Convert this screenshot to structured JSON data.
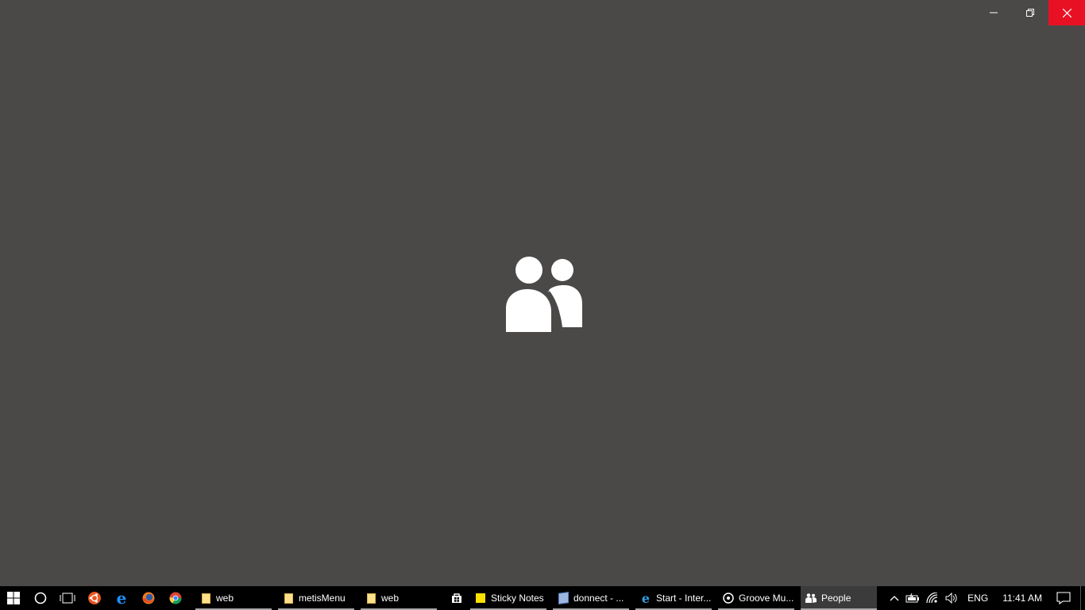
{
  "window": {
    "caption": {
      "minimize_icon": "minimize-icon",
      "restore_icon": "restore-icon",
      "close_icon": "close-icon"
    },
    "splash_icon": "people-icon",
    "background_color": "#4a4948",
    "close_hover_color": "#e81123"
  },
  "taskbar": {
    "pinned": [
      {
        "name": "start-button",
        "icon": "windows-logo-icon"
      },
      {
        "name": "cortana-button",
        "icon": "cortana-circle-icon"
      },
      {
        "name": "task-view-button",
        "icon": "task-view-icon"
      },
      {
        "name": "ubuntu-button",
        "icon": "ubuntu-icon"
      },
      {
        "name": "edge-button",
        "icon": "edge-icon"
      },
      {
        "name": "firefox-button",
        "icon": "firefox-icon"
      },
      {
        "name": "chrome-button",
        "icon": "chrome-icon"
      }
    ],
    "apps": [
      {
        "label": "web",
        "icon": "folder-icon"
      },
      {
        "label": "metisMenu",
        "icon": "folder-icon"
      },
      {
        "label": "web",
        "icon": "folder-icon"
      },
      {
        "label": "Sticky Notes",
        "icon": "sticky-notes-icon"
      },
      {
        "label": "donnect - ...",
        "icon": "virtualbox-icon"
      },
      {
        "label": "Start - Inter...",
        "icon": "internet-explorer-icon"
      },
      {
        "label": "Groove Mu...",
        "icon": "groove-music-icon"
      },
      {
        "label": "People",
        "icon": "people-icon"
      }
    ],
    "store_icon": "store-icon",
    "tray": {
      "chevron_icon": "chevron-up-icon",
      "battery_icon": "battery-icon",
      "wifi_icon": "wifi-icon",
      "volume_icon": "volume-icon",
      "language": "ENG",
      "time": "11:41 AM",
      "notification_icon": "action-center-icon"
    }
  }
}
